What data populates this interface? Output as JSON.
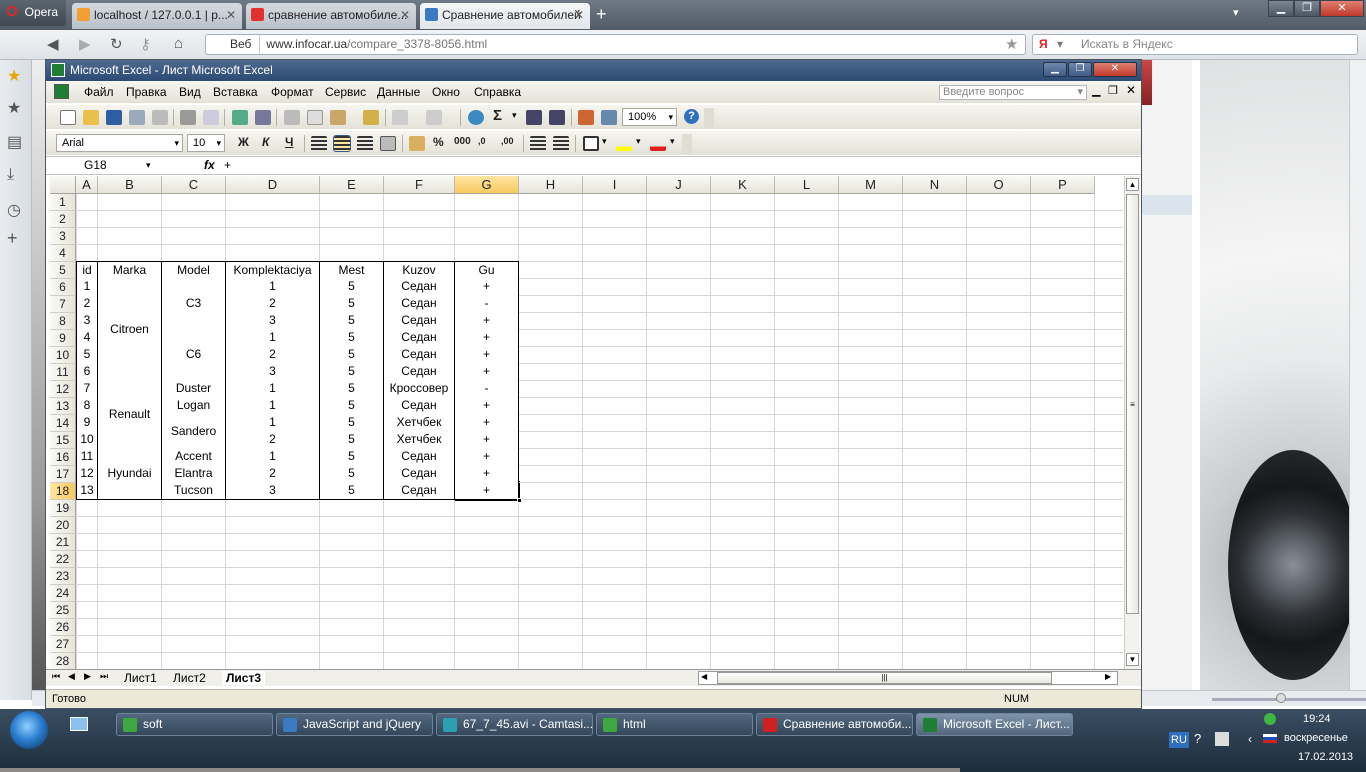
{
  "browser": {
    "opera_label": "Opera",
    "tabs": [
      {
        "title": "localhost / 127.0.0.1 | p...",
        "favicon_color": "#f0a030"
      },
      {
        "title": "сравнение автомобиле...",
        "favicon_color": "#e03030"
      },
      {
        "title": "Сравнение автомобилей",
        "favicon_color": "#3a7ac0"
      }
    ],
    "new_tab": "+",
    "address_prefix": "Веб",
    "url_host": "www.infocar.ua",
    "url_path": "/compare_3378-8056.html",
    "search_badge": "Я",
    "search_placeholder": "Искать в Яндекс"
  },
  "excel": {
    "title": "Microsoft Excel - Лист Microsoft Excel",
    "menu": [
      "Файл",
      "Правка",
      "Вид",
      "Вставка",
      "Формат",
      "Сервис",
      "Данные",
      "Окно",
      "Справка"
    ],
    "help_placeholder": "Введите вопрос",
    "zoom": "100%",
    "font_name": "Arial",
    "font_size": "10",
    "bold_glyph": "Ж",
    "italic_glyph": "К",
    "underline_glyph": "Ч",
    "percent_glyph": "%",
    "thousands_glyph": "000",
    "inc_decimal_glyph": ",0",
    "dec_decimal_glyph": ",00",
    "sum_glyph": "Σ",
    "help_glyph": "?",
    "name_box": "G18",
    "fx_label": "fx",
    "formula": "+",
    "columns": [
      "A",
      "B",
      "C",
      "D",
      "E",
      "F",
      "G",
      "H",
      "I",
      "J",
      "K",
      "L",
      "M",
      "N",
      "O",
      "P"
    ],
    "rows": [
      "1",
      "2",
      "3",
      "4",
      "5",
      "6",
      "7",
      "8",
      "9",
      "10",
      "11",
      "12",
      "13",
      "14",
      "15",
      "16",
      "17",
      "18",
      "19",
      "20",
      "21",
      "22",
      "23",
      "24",
      "25",
      "26",
      "27",
      "28"
    ],
    "selected_column": "G",
    "selected_row": "18",
    "table": {
      "headers": [
        "id",
        "Marka",
        "Model",
        "Komplektaciya",
        "Mest",
        "Kuzov",
        "Gu"
      ],
      "ids": [
        "1",
        "2",
        "3",
        "4",
        "5",
        "6",
        "7",
        "8",
        "9",
        "10",
        "11",
        "12",
        "13"
      ],
      "marka": [
        "Citroen",
        "Renault",
        "Hyundai"
      ],
      "models": [
        "C3",
        "C6",
        "Duster",
        "Logan",
        "Sandero",
        "Accent",
        "Elantra",
        "Tucson"
      ],
      "komplektaciya": [
        "1",
        "2",
        "3",
        "1",
        "2",
        "3",
        "1",
        "1",
        "1",
        "2",
        "1",
        "2",
        "3"
      ],
      "mest": [
        "5",
        "5",
        "5",
        "5",
        "5",
        "5",
        "5",
        "5",
        "5",
        "5",
        "5",
        "5",
        "5"
      ],
      "kuzov": [
        "Седан",
        "Седан",
        "Седан",
        "Седан",
        "Седан",
        "Седан",
        "Кроссовер",
        "Седан",
        "Хетчбек",
        "Хетчбек",
        "Седан",
        "Седан",
        "Седан"
      ],
      "gu": [
        "+",
        "-",
        "+",
        "+",
        "+",
        "+",
        "-",
        "+",
        "+",
        "+",
        "+",
        "+",
        "+"
      ]
    },
    "sheets": [
      "Лист1",
      "Лист2",
      "Лист3"
    ],
    "active_sheet": "Лист3",
    "status_ready": "Готово",
    "status_num": "NUM"
  },
  "taskbar": {
    "items": [
      {
        "label": "soft",
        "icon_color": "#3fa83f"
      },
      {
        "label": "JavaScript and jQuery",
        "icon_color": "#3a7ac0"
      },
      {
        "label": "67_7_45.avi - Camtasi...",
        "icon_color": "#2aa0b0"
      },
      {
        "label": "html",
        "icon_color": "#3fa83f"
      },
      {
        "label": "Сравнение автомоби...",
        "icon_color": "#d02020"
      },
      {
        "label": "Microsoft Excel - Лист...",
        "icon_color": "#1e7e34"
      }
    ],
    "lang": "RU",
    "time": "19:24",
    "weekday": "воскресенье",
    "date": "17.02.2013"
  }
}
